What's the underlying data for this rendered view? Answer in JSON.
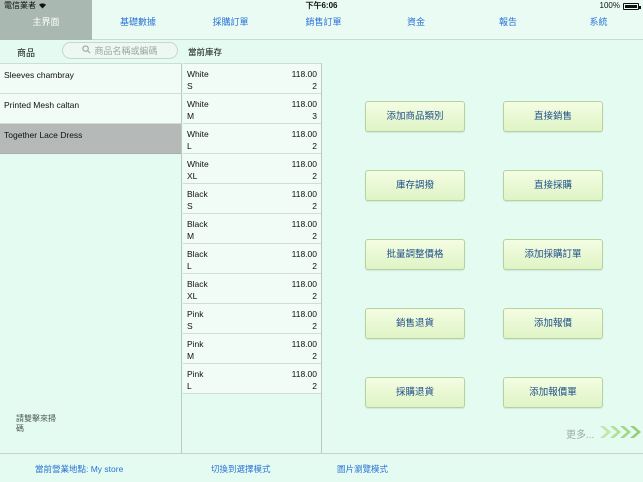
{
  "status": {
    "carrier": "電信業者",
    "time": "下午6:06",
    "battery": "100%"
  },
  "tabs": [
    {
      "label": "主界面",
      "active": true
    },
    {
      "label": "基礎數據"
    },
    {
      "label": "採購訂單"
    },
    {
      "label": "銷售訂單"
    },
    {
      "label": "資金"
    },
    {
      "label": "報告"
    },
    {
      "label": "系統"
    }
  ],
  "product_panel": {
    "header": "商品",
    "search_placeholder": "商品名稱或編碼",
    "items": [
      {
        "name": "Sleeves chambray"
      },
      {
        "name": "Printed Mesh caltan"
      },
      {
        "name": "Together Lace Dress",
        "selected": true
      }
    ],
    "scan_hint": "請雙擊來掃碼"
  },
  "stock_panel": {
    "header": "當前庫存",
    "rows": [
      {
        "color": "White",
        "size": "S",
        "price": "118.00",
        "qty": "2"
      },
      {
        "color": "White",
        "size": "M",
        "price": "118.00",
        "qty": "3"
      },
      {
        "color": "White",
        "size": "L",
        "price": "118.00",
        "qty": "2"
      },
      {
        "color": "White",
        "size": "XL",
        "price": "118.00",
        "qty": "2"
      },
      {
        "color": "Black",
        "size": "S",
        "price": "118.00",
        "qty": "2"
      },
      {
        "color": "Black",
        "size": "M",
        "price": "118.00",
        "qty": "2"
      },
      {
        "color": "Black",
        "size": "L",
        "price": "118.00",
        "qty": "2"
      },
      {
        "color": "Black",
        "size": "XL",
        "price": "118.00",
        "qty": "2"
      },
      {
        "color": "Pink",
        "size": "S",
        "price": "118.00",
        "qty": "2"
      },
      {
        "color": "Pink",
        "size": "M",
        "price": "118.00",
        "qty": "2"
      },
      {
        "color": "Pink",
        "size": "L",
        "price": "118.00",
        "qty": "2"
      }
    ]
  },
  "actions": {
    "add_category": "添加商品類別",
    "direct_sale": "直接銷售",
    "stock_transfer": "庫存調撥",
    "direct_purchase": "直接採購",
    "batch_price": "批量調整價格",
    "add_purchase_order": "添加採購訂單",
    "sales_return": "銷售退貨",
    "add_quote": "添加報價",
    "purchase_return": "採購退貨",
    "add_quote_sheet": "添加報價單",
    "more": "更多..."
  },
  "bottom": {
    "current_store": "當前營業地點: My store",
    "switch_mode": "切換到選擇模式",
    "image_mode": "圖片瀏覽模式"
  },
  "colors": {
    "background": "#e4fbf1",
    "tab_text": "#2a73d8",
    "active_tab": "#a9b8b0",
    "selected_row": "#b5b9b7",
    "button_bg": "#e8f8d4"
  }
}
